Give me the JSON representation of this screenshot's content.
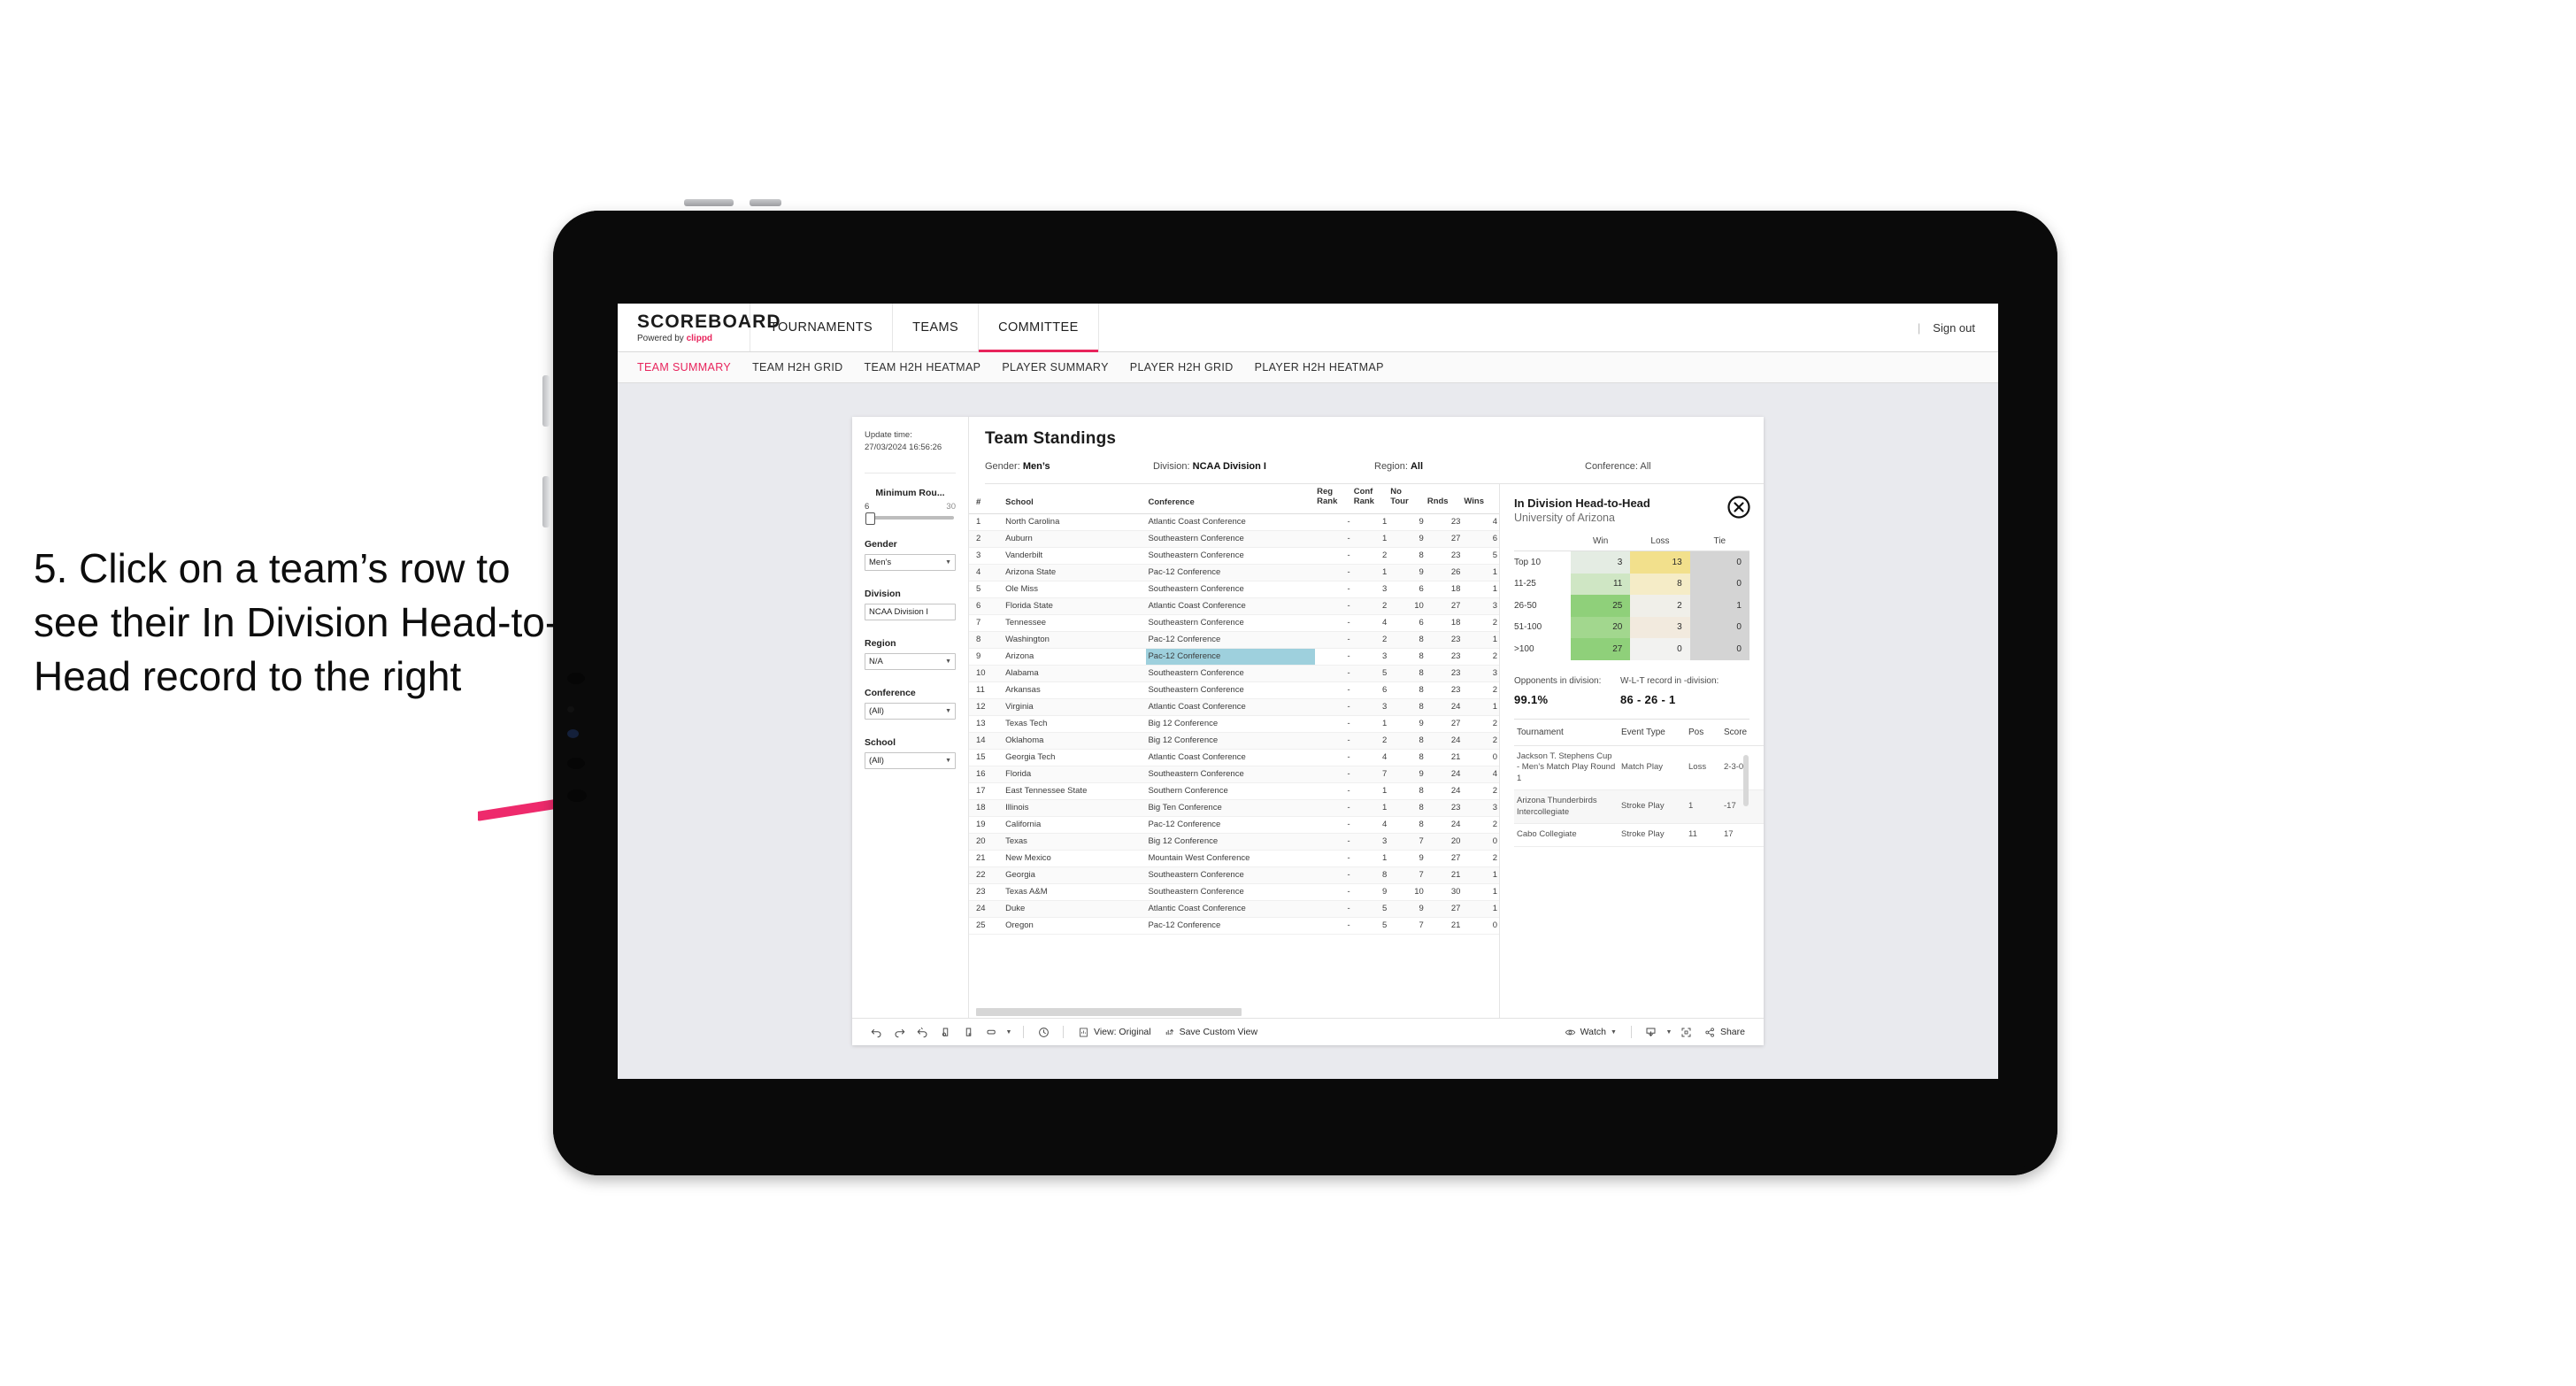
{
  "annotation": {
    "text": "5. Click on a team’s row to see their In Division Head-to-Head record to the right",
    "arrow_color": "#ee2a6c"
  },
  "app": {
    "logo": {
      "name": "SCOREBOARD",
      "powered_prefix": "Powered by ",
      "powered_brand": "clippd"
    },
    "nav": [
      {
        "label": "TOURNAMENTS",
        "active": false
      },
      {
        "label": "TEAMS",
        "active": false
      },
      {
        "label": "COMMITTEE",
        "active": true
      }
    ],
    "sign_out": "Sign out",
    "sign_out_divider": "|",
    "subnav": [
      {
        "label": "TEAM SUMMARY",
        "active": true
      },
      {
        "label": "TEAM H2H GRID",
        "active": false
      },
      {
        "label": "TEAM H2H HEATMAP",
        "active": false
      },
      {
        "label": "PLAYER SUMMARY",
        "active": false
      },
      {
        "label": "PLAYER H2H GRID",
        "active": false
      },
      {
        "label": "PLAYER H2H HEATMAP",
        "active": false
      }
    ]
  },
  "filters": {
    "update_time_label": "Update time:",
    "update_time_value": "27/03/2024 16:56:26",
    "slider": {
      "label": "Minimum Rou...",
      "min": "6",
      "max": "30",
      "value": 6
    },
    "groups": [
      {
        "label": "Gender",
        "value": "Men’s"
      },
      {
        "label": "Division",
        "value": "NCAA Division I"
      },
      {
        "label": "Region",
        "value": "N/A"
      },
      {
        "label": "Conference",
        "value": "(All)"
      },
      {
        "label": "School",
        "value": "(All)"
      }
    ]
  },
  "standings": {
    "title": "Team Standings",
    "meta": [
      {
        "label": "Gender: ",
        "value": "Men’s"
      },
      {
        "label": "Division: ",
        "value": "NCAA Division I"
      },
      {
        "label": "Region: ",
        "value": "All"
      },
      {
        "label": "Conference: ",
        "value": "All"
      }
    ],
    "columns": [
      "#",
      "School",
      "Conference",
      "Reg Rank",
      "Conf Rank",
      "No Tour",
      "Rnds",
      "Wins"
    ],
    "columns_display": [
      {
        "l1": "#",
        "l2": ""
      },
      {
        "l1": "School",
        "l2": ""
      },
      {
        "l1": "Conference",
        "l2": ""
      },
      {
        "l1": "Reg",
        "l2": "Rank"
      },
      {
        "l1": "Conf",
        "l2": "Rank"
      },
      {
        "l1": "No",
        "l2": "Tour"
      },
      {
        "l1": "Rnds",
        "l2": ""
      },
      {
        "l1": "Wins",
        "l2": ""
      }
    ],
    "selected_row": 9,
    "rows": [
      {
        "num": "1",
        "school": "North Carolina",
        "conference": "Atlantic Coast Conference",
        "reg": "-",
        "conf": "1",
        "notour": "9",
        "rnds": "23",
        "wins": "4"
      },
      {
        "num": "2",
        "school": "Auburn",
        "conference": "Southeastern Conference",
        "reg": "-",
        "conf": "1",
        "notour": "9",
        "rnds": "27",
        "wins": "6"
      },
      {
        "num": "3",
        "school": "Vanderbilt",
        "conference": "Southeastern Conference",
        "reg": "-",
        "conf": "2",
        "notour": "8",
        "rnds": "23",
        "wins": "5"
      },
      {
        "num": "4",
        "school": "Arizona State",
        "conference": "Pac-12 Conference",
        "reg": "-",
        "conf": "1",
        "notour": "9",
        "rnds": "26",
        "wins": "1"
      },
      {
        "num": "5",
        "school": "Ole Miss",
        "conference": "Southeastern Conference",
        "reg": "-",
        "conf": "3",
        "notour": "6",
        "rnds": "18",
        "wins": "1"
      },
      {
        "num": "6",
        "school": "Florida State",
        "conference": "Atlantic Coast Conference",
        "reg": "-",
        "conf": "2",
        "notour": "10",
        "rnds": "27",
        "wins": "3"
      },
      {
        "num": "7",
        "school": "Tennessee",
        "conference": "Southeastern Conference",
        "reg": "-",
        "conf": "4",
        "notour": "6",
        "rnds": "18",
        "wins": "2"
      },
      {
        "num": "8",
        "school": "Washington",
        "conference": "Pac-12 Conference",
        "reg": "-",
        "conf": "2",
        "notour": "8",
        "rnds": "23",
        "wins": "1"
      },
      {
        "num": "9",
        "school": "Arizona",
        "conference": "Pac-12 Conference",
        "reg": "-",
        "conf": "3",
        "notour": "8",
        "rnds": "23",
        "wins": "2"
      },
      {
        "num": "10",
        "school": "Alabama",
        "conference": "Southeastern Conference",
        "reg": "-",
        "conf": "5",
        "notour": "8",
        "rnds": "23",
        "wins": "3"
      },
      {
        "num": "11",
        "school": "Arkansas",
        "conference": "Southeastern Conference",
        "reg": "-",
        "conf": "6",
        "notour": "8",
        "rnds": "23",
        "wins": "2"
      },
      {
        "num": "12",
        "school": "Virginia",
        "conference": "Atlantic Coast Conference",
        "reg": "-",
        "conf": "3",
        "notour": "8",
        "rnds": "24",
        "wins": "1"
      },
      {
        "num": "13",
        "school": "Texas Tech",
        "conference": "Big 12 Conference",
        "reg": "-",
        "conf": "1",
        "notour": "9",
        "rnds": "27",
        "wins": "2"
      },
      {
        "num": "14",
        "school": "Oklahoma",
        "conference": "Big 12 Conference",
        "reg": "-",
        "conf": "2",
        "notour": "8",
        "rnds": "24",
        "wins": "2"
      },
      {
        "num": "15",
        "school": "Georgia Tech",
        "conference": "Atlantic Coast Conference",
        "reg": "-",
        "conf": "4",
        "notour": "8",
        "rnds": "21",
        "wins": "0"
      },
      {
        "num": "16",
        "school": "Florida",
        "conference": "Southeastern Conference",
        "reg": "-",
        "conf": "7",
        "notour": "9",
        "rnds": "24",
        "wins": "4"
      },
      {
        "num": "17",
        "school": "East Tennessee State",
        "conference": "Southern Conference",
        "reg": "-",
        "conf": "1",
        "notour": "8",
        "rnds": "24",
        "wins": "2"
      },
      {
        "num": "18",
        "school": "Illinois",
        "conference": "Big Ten Conference",
        "reg": "-",
        "conf": "1",
        "notour": "8",
        "rnds": "23",
        "wins": "3"
      },
      {
        "num": "19",
        "school": "California",
        "conference": "Pac-12 Conference",
        "reg": "-",
        "conf": "4",
        "notour": "8",
        "rnds": "24",
        "wins": "2"
      },
      {
        "num": "20",
        "school": "Texas",
        "conference": "Big 12 Conference",
        "reg": "-",
        "conf": "3",
        "notour": "7",
        "rnds": "20",
        "wins": "0"
      },
      {
        "num": "21",
        "school": "New Mexico",
        "conference": "Mountain West Conference",
        "reg": "-",
        "conf": "1",
        "notour": "9",
        "rnds": "27",
        "wins": "2"
      },
      {
        "num": "22",
        "school": "Georgia",
        "conference": "Southeastern Conference",
        "reg": "-",
        "conf": "8",
        "notour": "7",
        "rnds": "21",
        "wins": "1"
      },
      {
        "num": "23",
        "school": "Texas A&M",
        "conference": "Southeastern Conference",
        "reg": "-",
        "conf": "9",
        "notour": "10",
        "rnds": "30",
        "wins": "1"
      },
      {
        "num": "24",
        "school": "Duke",
        "conference": "Atlantic Coast Conference",
        "reg": "-",
        "conf": "5",
        "notour": "9",
        "rnds": "27",
        "wins": "1"
      },
      {
        "num": "25",
        "school": "Oregon",
        "conference": "Pac-12 Conference",
        "reg": "-",
        "conf": "5",
        "notour": "7",
        "rnds": "21",
        "wins": "0"
      }
    ]
  },
  "h2h": {
    "title": "In Division Head-to-Head",
    "subtitle": "University of Arizona",
    "close_icon": "close-circle-icon",
    "chart_data": {
      "type": "heatmap",
      "title": "In Division Head-to-Head",
      "subtitle": "University of Arizona",
      "columns": [
        "Win",
        "Loss",
        "Tie"
      ],
      "rows": [
        "Top 10",
        "11-25",
        "26-50",
        "51-100",
        ">100"
      ],
      "values": [
        [
          3,
          13,
          0
        ],
        [
          11,
          8,
          0
        ],
        [
          25,
          2,
          1
        ],
        [
          20,
          3,
          0
        ],
        [
          27,
          0,
          0
        ]
      ],
      "cell_colors": [
        [
          "#e4ece3",
          "#f2e08c",
          "#d4d4d4"
        ],
        [
          "#cfe6c4",
          "#f5ecc7",
          "#d4d4d4"
        ],
        [
          "#8fd07a",
          "#f0efe9",
          "#d4d4d4"
        ],
        [
          "#a2d78e",
          "#f2eade",
          "#d4d4d4"
        ],
        [
          "#8fd07a",
          "#f2f2f0",
          "#d4d4d4"
        ]
      ]
    },
    "stats": [
      {
        "label": "Opponents in division:",
        "value": "99.1%"
      },
      {
        "label": "W-L-T record in -division:",
        "value": "86 - 26 - 1"
      }
    ],
    "tournaments": {
      "columns": [
        "Tournament",
        "Event Type",
        "Pos",
        "Score"
      ],
      "rows": [
        {
          "name": "Jackson T. Stephens Cup - Men’s Match Play Round 1",
          "type": "Match Play",
          "pos": "Loss",
          "score": "2-3-0"
        },
        {
          "name": "Arizona Thunderbirds Intercollegiate",
          "type": "Stroke Play",
          "pos": "1",
          "score": "-17"
        },
        {
          "name": "Cabo Collegiate",
          "type": "Stroke Play",
          "pos": "11",
          "score": "17"
        }
      ]
    }
  },
  "toolbar": {
    "icons": [
      "undo-icon",
      "redo-icon",
      "revert-icon",
      "refresh-data-icon",
      "pause-refresh-icon",
      "alerts-icon",
      "alerts-dropdown-icon",
      "timer-icon"
    ],
    "view_label": "View: Original",
    "view_icon": "view-icon",
    "save_label": "Save Custom View",
    "save_icon": "save-view-icon",
    "watch_label": "Watch",
    "watch_icon": "eye-icon",
    "download_icon": "download-icon",
    "fullscreen_icon": "fullscreen-icon",
    "share_label": "Share",
    "share_icon": "share-icon"
  }
}
